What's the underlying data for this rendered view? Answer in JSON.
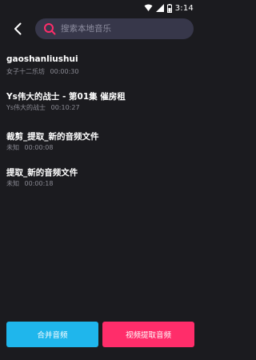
{
  "status_bar": {
    "time": "3:14",
    "icons": [
      "wifi-icon",
      "signal-icon",
      "battery-icon"
    ]
  },
  "search": {
    "placeholder": "搜索本地音乐"
  },
  "items": [
    {
      "title": "gaoshanliushui",
      "artist": "女子十二乐坊",
      "duration": "00:00:30"
    },
    {
      "title": "Ys伟大的战士 - 第01集 催房租",
      "artist": "Ys伟大的战士",
      "duration": "00:10:27"
    },
    {
      "title": "裁剪_提取_新的音频文件",
      "artist": "未知",
      "duration": "00:00:08"
    },
    {
      "title": "提取_新的音频文件",
      "artist": "未知",
      "duration": "00:00:18"
    }
  ],
  "buttons": {
    "merge": "合并音频",
    "extract": "视频提取音频"
  },
  "colors": {
    "background": "#1b1b1f",
    "search_bg": "#37374a",
    "accent_pink": "#ff2d6a",
    "accent_cyan": "#1fb6ec",
    "meta_text": "#8a8a93"
  }
}
